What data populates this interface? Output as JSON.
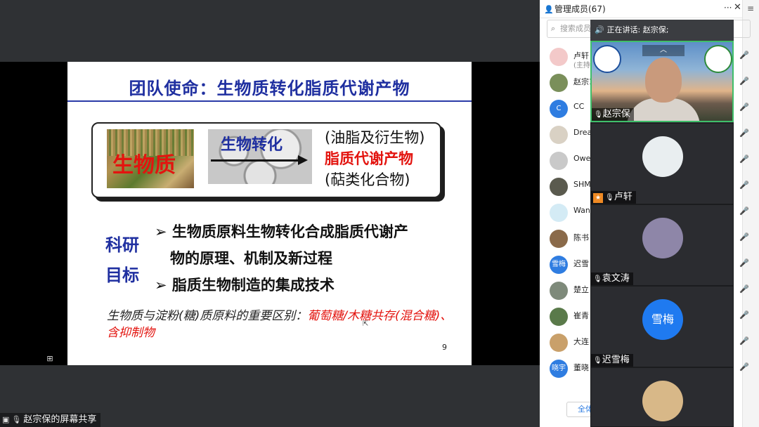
{
  "slide": {
    "title": "团队使命：生物质转化脂质代谢产物",
    "biomass_label": "生物质",
    "process_label": "生物转化",
    "products": [
      "(油脂及衍生物)",
      "脂质代谢产物",
      "(萜类化合物)"
    ],
    "goal_label_1": "科研",
    "goal_label_2": "目标",
    "bullet_1": "➢ 生物质原料生物转化合成脂质代谢产",
    "bullet_2": "物的原理、机制及新过程",
    "bullet_3": "➢ 脂质生物制造的集成技术",
    "note_black": "生物质与淀粉(糖)质原料的重要区别：",
    "note_red": "葡萄糖/木糖共存(混合糖)、含抑制物",
    "page_number": "9"
  },
  "share_caption": "赵宗保的屏幕共享",
  "panel": {
    "title": "管理成员(67)",
    "more": "···",
    "close": "✕",
    "menu": "≡",
    "search_placeholder": "搜索成员",
    "search_icon": "search-icon",
    "bottom_button": "全体"
  },
  "members": [
    {
      "name": "卢轩",
      "sub": "(主持",
      "avatar_text": "",
      "avatar_color": "#f3c9c9"
    },
    {
      "name": "赵宗1",
      "sub": "",
      "avatar_text": "",
      "avatar_color": "#7a8f5a"
    },
    {
      "name": "CC",
      "sub": "",
      "avatar_text": "C",
      "avatar_color": "#2f7de1"
    },
    {
      "name": "Drea",
      "sub": "",
      "avatar_text": "",
      "avatar_color": "#d9d1c4"
    },
    {
      "name": "Owe",
      "sub": "",
      "avatar_text": "",
      "avatar_color": "#c9c9c9"
    },
    {
      "name": "SHM",
      "sub": "",
      "avatar_text": "",
      "avatar_color": "#5a5a4e"
    },
    {
      "name": "Wan",
      "sub": "",
      "avatar_text": "",
      "avatar_color": "#d4ebf5"
    },
    {
      "name": "陈书",
      "sub": "",
      "avatar_text": "",
      "avatar_color": "#8a6a4a"
    },
    {
      "name": "迟雪",
      "sub": "",
      "avatar_text": "雪梅",
      "avatar_color": "#2f7de1"
    },
    {
      "name": "楚立",
      "sub": "",
      "avatar_text": "",
      "avatar_color": "#7e8a7a"
    },
    {
      "name": "崔青",
      "sub": "",
      "avatar_text": "",
      "avatar_color": "#5a7a4a"
    },
    {
      "name": "大连",
      "sub": "",
      "avatar_text": "",
      "avatar_color": "#c9a06a"
    },
    {
      "name": "董晓",
      "sub": "",
      "avatar_text": "晓宇",
      "avatar_color": "#2f7de1"
    }
  ],
  "video": {
    "speaking_prefix": "正在讲话: ",
    "speaking_name": "赵宗保;",
    "tiles": [
      {
        "name": "赵宗保",
        "circle_text": "",
        "circle_color": "",
        "active": true
      },
      {
        "name": "卢轩",
        "circle_text": "",
        "circle_color": "#e9eef0",
        "active": false
      },
      {
        "name": "袁文涛",
        "circle_text": "",
        "circle_color": "#8e86a8",
        "active": false
      },
      {
        "name": "迟雪梅",
        "circle_text": "雪梅",
        "circle_color": "#1f7af0",
        "active": false
      },
      {
        "name": "",
        "circle_text": "",
        "circle_color": "#d8b888",
        "active": false
      }
    ]
  }
}
